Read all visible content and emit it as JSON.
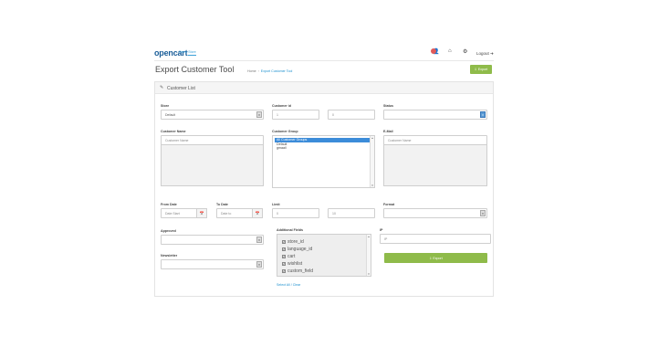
{
  "header": {
    "logo_text": "opencart",
    "logo_sub": "Demo Store",
    "logout_label": "Logout",
    "icons": [
      "notification-icon",
      "home-icon",
      "help-icon",
      "logout-icon"
    ]
  },
  "page": {
    "title": "Export Customer Tool",
    "breadcrumb": [
      "Home",
      "Export Customer Tool"
    ],
    "export_button": "Export"
  },
  "panel": {
    "title": "Customer List",
    "store": {
      "label": "Store",
      "value": "Default"
    },
    "customer_id": {
      "label": "Customer id",
      "from_placeholder": "1",
      "to_placeholder": "0"
    },
    "status": {
      "label": "Status",
      "value": ""
    },
    "customer_name": {
      "label": "Customer Name",
      "placeholder": "Customer Name"
    },
    "customer_group": {
      "label": "Customer Group",
      "options": [
        "All Customer Groups",
        "Default",
        "gmaail"
      ],
      "selected": "All Customer Groups"
    },
    "email": {
      "label": "E-Mail",
      "placeholder": "Customer Name"
    },
    "from_date": {
      "label": "From Date",
      "placeholder": "Date Start"
    },
    "to_date": {
      "label": "To Date",
      "placeholder": "Date to"
    },
    "limit": {
      "label": "Limit",
      "from_placeholder": "0",
      "to_placeholder": "10"
    },
    "format": {
      "label": "Format",
      "value": ""
    },
    "approved": {
      "label": "Approved",
      "value": ""
    },
    "additional_fields": {
      "label": "Additional Fields",
      "items": [
        "store_id",
        "language_id",
        "cart",
        "wishlist",
        "custom_field"
      ]
    },
    "newsletter": {
      "label": "Newsletter",
      "value": ""
    },
    "ip": {
      "label": "IP",
      "placeholder": "IP"
    },
    "export_button": "Export",
    "select_clear": "Select All / Clear"
  },
  "colors": {
    "accent_green": "#8fbb4a",
    "link_blue": "#1e91cf",
    "selected_blue": "#3c8cd9"
  }
}
